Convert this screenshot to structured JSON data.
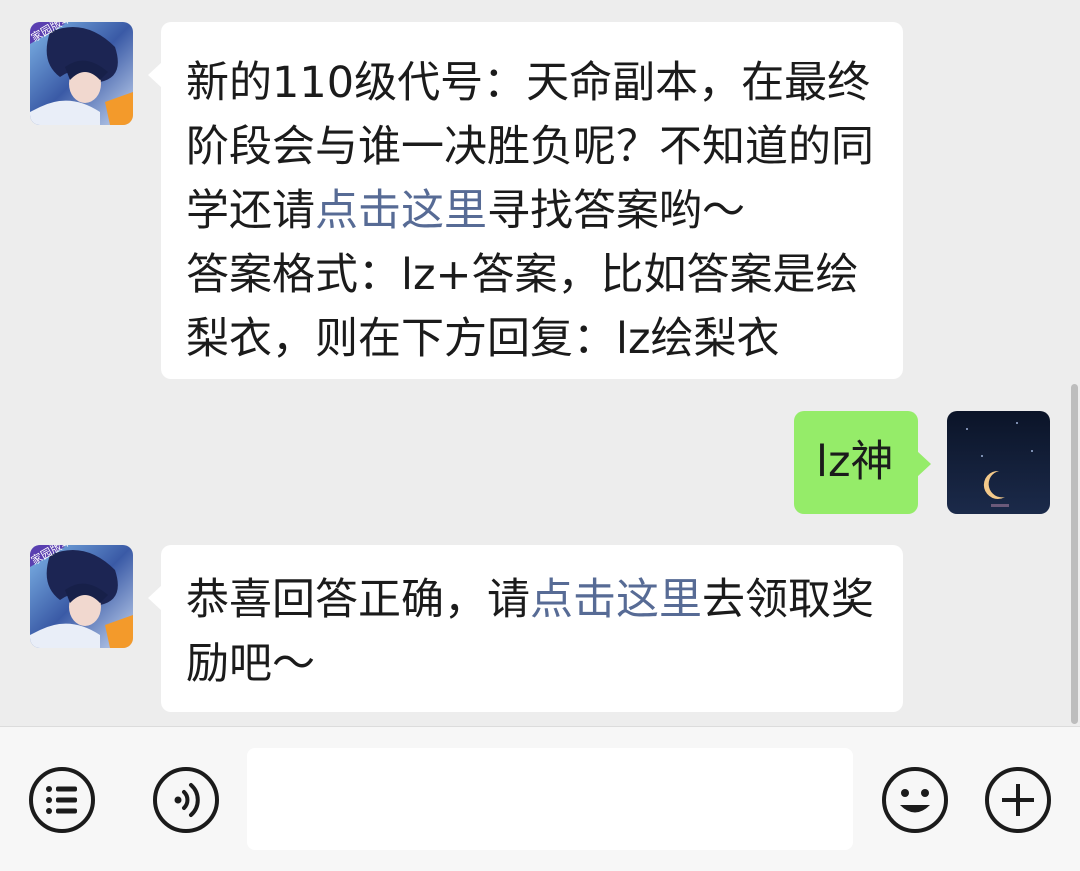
{
  "messages": [
    {
      "side": "in",
      "sender": "game-official",
      "avatar_badge": "家园版本",
      "segments": [
        {
          "text": "新的110级代号：天命副本，在最终阶段会与谁一决胜负呢？不知道的同学还请",
          "link": false
        },
        {
          "text": "点击这里",
          "link": true
        },
        {
          "text": "寻找答案哟～",
          "link": false
        }
      ],
      "line2": "答案格式：lz+答案，比如答案是绘梨衣，则在下方回复：lz绘梨衣"
    },
    {
      "side": "out",
      "sender": "me",
      "text": "lz神"
    },
    {
      "side": "in",
      "sender": "game-official",
      "avatar_badge": "家园版本",
      "segments": [
        {
          "text": "恭喜回答正确，请",
          "link": false
        },
        {
          "text": "点击这里",
          "link": true
        },
        {
          "text": "去领取奖励吧～",
          "link": false
        }
      ]
    }
  ],
  "input_bar": {
    "value": "",
    "icons": [
      "menu-list-icon",
      "voice-icon",
      "emoji-icon",
      "plus-icon"
    ]
  },
  "colors": {
    "background": "#ededed",
    "bubble_in": "#ffffff",
    "bubble_out": "#95ec69",
    "link": "#576b95"
  }
}
